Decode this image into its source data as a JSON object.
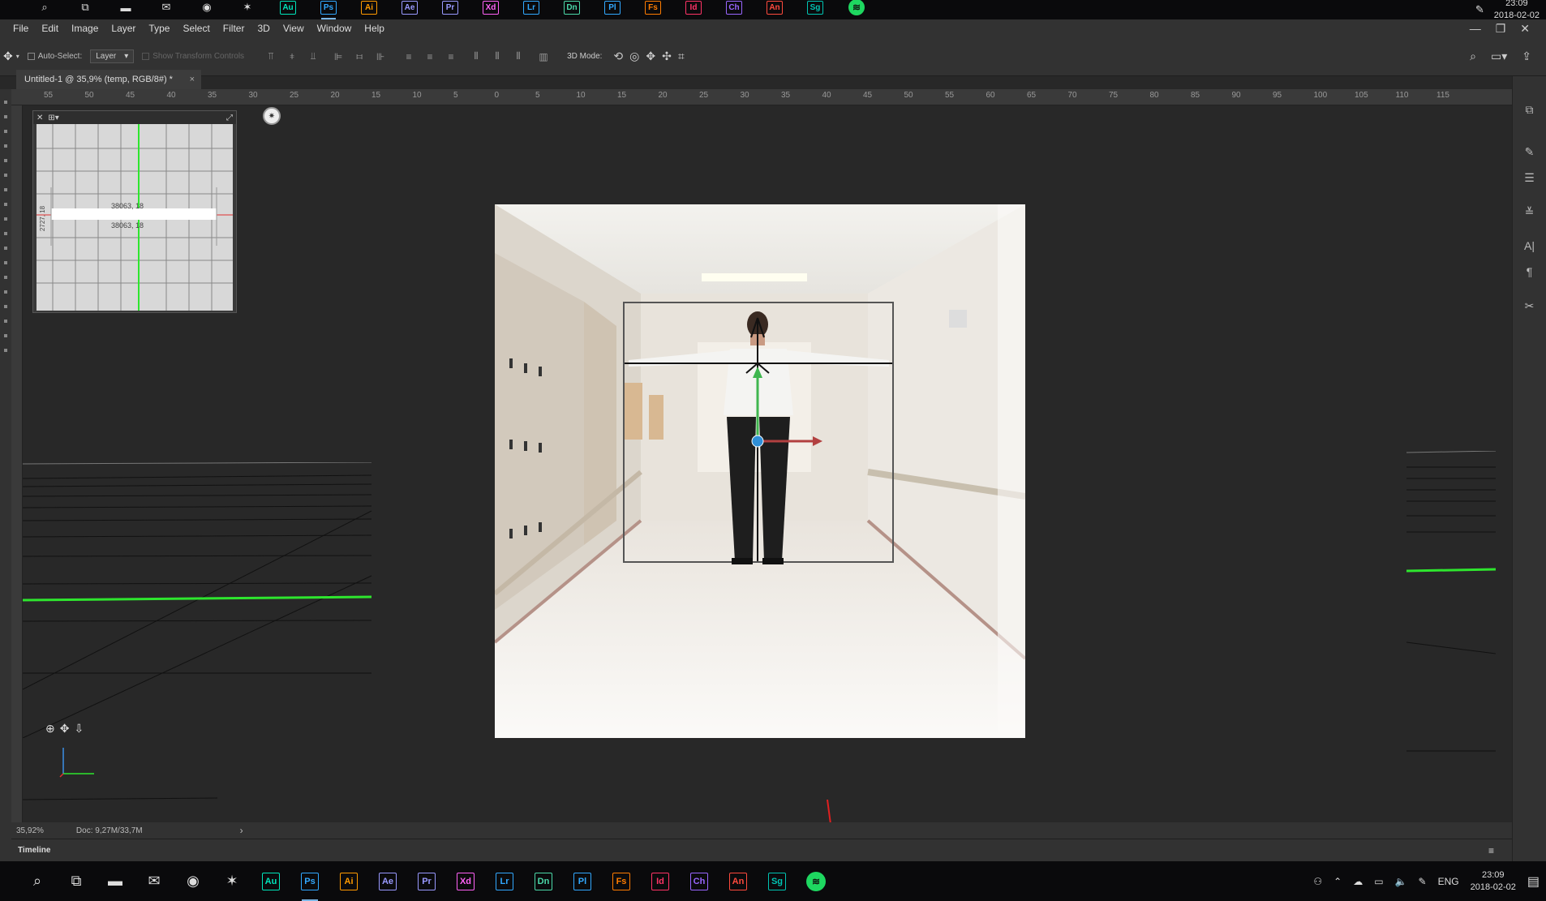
{
  "taskbar_top": {
    "apps": [
      {
        "id": "search",
        "label": "⌕"
      },
      {
        "id": "taskview",
        "label": "⧉"
      },
      {
        "id": "explorer",
        "label": "▬"
      },
      {
        "id": "mail",
        "label": "✉"
      },
      {
        "id": "chrome",
        "label": "◉"
      },
      {
        "id": "blender",
        "label": "✶"
      },
      {
        "id": "audition",
        "label": "Au",
        "color": "#00e4bb"
      },
      {
        "id": "photoshop",
        "label": "Ps",
        "color": "#31a8ff"
      },
      {
        "id": "illustrator",
        "label": "Ai",
        "color": "#ff9a00"
      },
      {
        "id": "aftereffects",
        "label": "Ae",
        "color": "#9999ff"
      },
      {
        "id": "premiere",
        "label": "Pr",
        "color": "#9999ff"
      },
      {
        "id": "xd",
        "label": "Xd",
        "color": "#ff61f6"
      },
      {
        "id": "lightroom",
        "label": "Lr",
        "color": "#31a8ff"
      },
      {
        "id": "dimension",
        "label": "Dn",
        "color": "#4bd9a9"
      },
      {
        "id": "prelude",
        "label": "Pl",
        "color": "#31a8ff"
      },
      {
        "id": "fuse",
        "label": "Fs",
        "color": "#ff7c00"
      },
      {
        "id": "indesign",
        "label": "Id",
        "color": "#ff3366"
      },
      {
        "id": "character",
        "label": "Ch",
        "color": "#9966ff"
      },
      {
        "id": "animate",
        "label": "An",
        "color": "#ff4a3d"
      },
      {
        "id": "substance",
        "label": "Sg",
        "color": "#00c4b3"
      }
    ],
    "time": "23:09",
    "date": "2018-02-02"
  },
  "menu": [
    "File",
    "Edit",
    "Image",
    "Layer",
    "Type",
    "Select",
    "Filter",
    "3D",
    "View",
    "Window",
    "Help"
  ],
  "options": {
    "auto_select_label": "Auto-Select:",
    "auto_select_value": "Layer",
    "show_transform_label": "Show Transform Controls",
    "mode_label": "3D Mode:"
  },
  "document": {
    "tab_title": "Untitled-1 @ 35,9% (temp, RGB/8#) *",
    "tab_close": "×"
  },
  "ruler_labels": [
    "55",
    "50",
    "45",
    "40",
    "35",
    "30",
    "25",
    "20",
    "15",
    "10",
    "5",
    "0",
    "5",
    "10",
    "15",
    "20",
    "25",
    "30",
    "35",
    "40",
    "45",
    "50",
    "55",
    "60",
    "65",
    "70",
    "75",
    "80",
    "85",
    "90",
    "95",
    "100",
    "105",
    "110",
    "115"
  ],
  "secondary_view": {
    "label1": "38063, 18",
    "label2": "38063, 18",
    "vlabel": "2727, 18"
  },
  "status": {
    "zoom": "35,92%",
    "doc": "Doc: 9,27M/33,7M",
    "arrow": "›"
  },
  "timeline": {
    "label": "Timeline"
  },
  "tray": {
    "lang": "ENG",
    "time": "23:09",
    "date": "2018-02-02"
  }
}
